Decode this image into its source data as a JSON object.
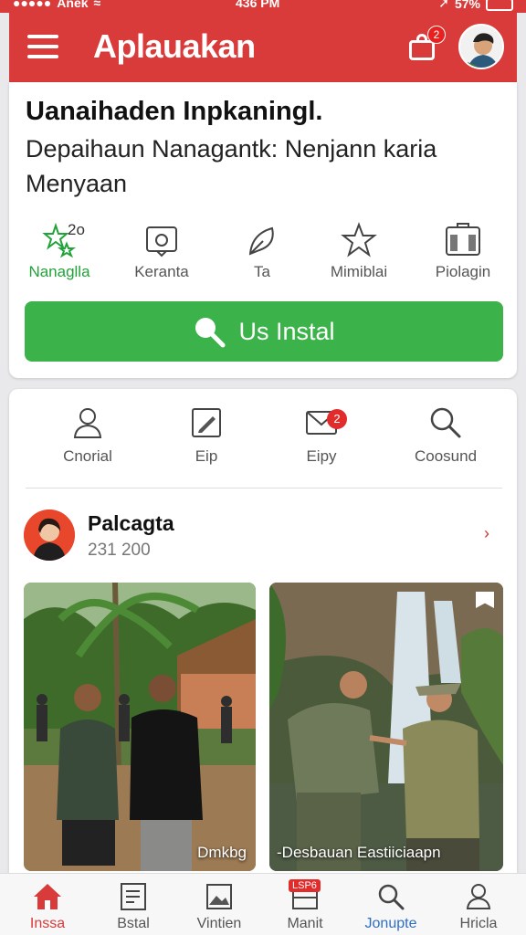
{
  "status_bar": {
    "carrier": "Anek",
    "time": "436 PM",
    "battery": "57%"
  },
  "header": {
    "title": "Aplauakan",
    "bag_badge": "2"
  },
  "install_card": {
    "headline": "Uanaihaden Inpkaningl.",
    "subline": "Depaihaun Nanagantk: Nenjann karia Menyaan",
    "actions": [
      {
        "label": "Nanaglla",
        "icon": "star-sparkle-icon",
        "count": "2o"
      },
      {
        "label": "Keranta",
        "icon": "camera-icon"
      },
      {
        "label": "Ta",
        "icon": "leaf-icon"
      },
      {
        "label": "Mimiblai",
        "icon": "star-icon"
      },
      {
        "label": "Piolagin",
        "icon": "bookmark-icon"
      }
    ],
    "install_label": "Us Instal"
  },
  "quick_actions": [
    {
      "label": "Cnorial",
      "icon": "person-icon"
    },
    {
      "label": "Eip",
      "icon": "edit-icon"
    },
    {
      "label": "Eipy",
      "icon": "mail-icon",
      "badge": "2"
    },
    {
      "label": "Coosund",
      "icon": "search-icon"
    }
  ],
  "post": {
    "name": "Palcagta",
    "stats": "231  200",
    "photos": [
      {
        "caption": "Dmkbg"
      },
      {
        "caption": "-Desbauan Eastiiciaapn"
      }
    ]
  },
  "bottom_nav": [
    {
      "label": "Inssa",
      "icon": "home-icon"
    },
    {
      "label": "Bstal",
      "icon": "document-icon"
    },
    {
      "label": "Vintien",
      "icon": "image-icon"
    },
    {
      "label": "Manit",
      "icon": "wallet-icon",
      "badge": "LSP6"
    },
    {
      "label": "Jonupte",
      "icon": "search-icon"
    },
    {
      "label": "Hricla",
      "icon": "user-icon"
    }
  ],
  "colors": {
    "brand_red": "#d93a3a",
    "install_green": "#3cb34a",
    "active_green": "#22a33a"
  }
}
